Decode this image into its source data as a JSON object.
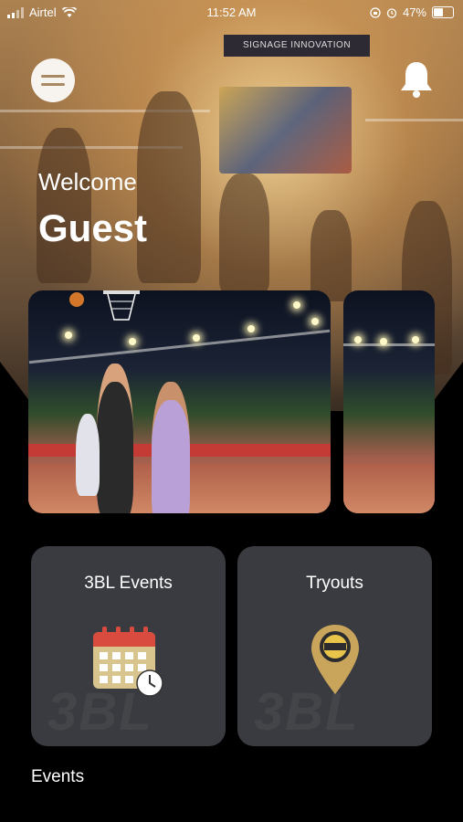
{
  "status_bar": {
    "carrier": "Airtel",
    "time": "11:52 AM",
    "battery": "47%"
  },
  "header": {
    "greeting": "Welcome",
    "user_name": "Guest",
    "menu_icon": "hamburger-menu-icon",
    "notification_icon": "bell-icon"
  },
  "hero": {
    "banner_text": "SIGNAGE INNOVATION"
  },
  "carousel": {
    "slides": [
      "basketball-match-photo-1",
      "basketball-match-photo-2"
    ]
  },
  "quick_links": [
    {
      "label": "3BL Events",
      "icon": "calendar-clock-icon"
    },
    {
      "label": "Tryouts",
      "icon": "location-pin-icon"
    }
  ],
  "watermark_text": "3BL",
  "sections": {
    "events_heading": "Events"
  },
  "colors": {
    "background": "#000000",
    "tile": "#3a3b40",
    "accent_gold": "#c9a55c",
    "calendar_red": "#d94b3f"
  }
}
